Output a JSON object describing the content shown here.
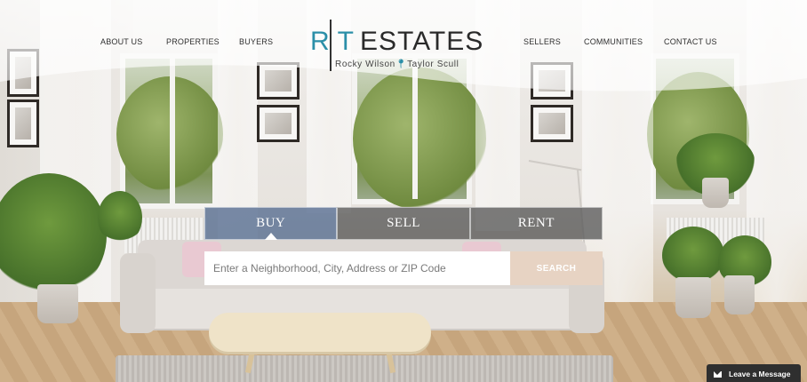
{
  "header": {
    "nav_left": [
      {
        "label": "ABOUT US"
      },
      {
        "label": "PROPERTIES"
      },
      {
        "label": "BUYERS"
      }
    ],
    "nav_right": [
      {
        "label": "SELLERS"
      },
      {
        "label": "COMMUNITIES"
      },
      {
        "label": "CONTACT US"
      }
    ],
    "logo": {
      "mark_left": "R",
      "mark_right": "T",
      "word": "ESTATES",
      "agent_one": "Rocky Wilson",
      "agent_two": "Taylor Scull",
      "accent_color": "#2b8fa8"
    }
  },
  "search": {
    "tabs": [
      {
        "label": "BUY",
        "active": true
      },
      {
        "label": "SELL",
        "active": false
      },
      {
        "label": "RENT",
        "active": false
      }
    ],
    "placeholder": "Enter a Neighborhood, City, Address or ZIP Code",
    "button_label": "SEARCH"
  },
  "chat": {
    "label": "Leave a Message",
    "icon": "envelope-icon"
  }
}
